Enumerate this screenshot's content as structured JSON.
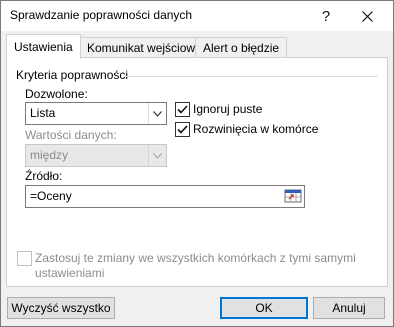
{
  "window": {
    "title": "Sprawdzanie poprawności danych"
  },
  "tabs": [
    {
      "label": "Ustawienia"
    },
    {
      "label": "Komunikat wejściowy"
    },
    {
      "label": "Alert o błędzie"
    }
  ],
  "settings": {
    "group_label": "Kryteria poprawności",
    "allow_label": "Dozwolone:",
    "allow_value": "Lista",
    "data_label": "Wartości danych:",
    "data_value": "między",
    "ignore_blank_label": "Ignoruj puste",
    "ignore_blank_checked": true,
    "in_cell_dropdown_label": "Rozwinięcia w komórce",
    "in_cell_dropdown_checked": true,
    "source_label": "Źródło:",
    "source_value": "=Oceny",
    "apply_all_label_line1": "Zastosuj te zmiany we wszystkich komórkach z tymi samymi",
    "apply_all_label_line2": "ustawieniami",
    "apply_all_checked": false
  },
  "buttons": {
    "clear_all": "Wyczyść wszystko",
    "ok": "OK",
    "cancel": "Anuluj"
  },
  "icons": {
    "help": "help-icon",
    "close": "close-icon",
    "dropdown": "chevron-down-icon",
    "range_ref": "range-select-icon",
    "check": "checkmark-icon"
  },
  "colors": {
    "accent": "#0078d7",
    "dialog_bg": "#f0f0f0",
    "range_icon_red": "#d83b2b",
    "range_icon_blue": "#2f5fbf"
  }
}
